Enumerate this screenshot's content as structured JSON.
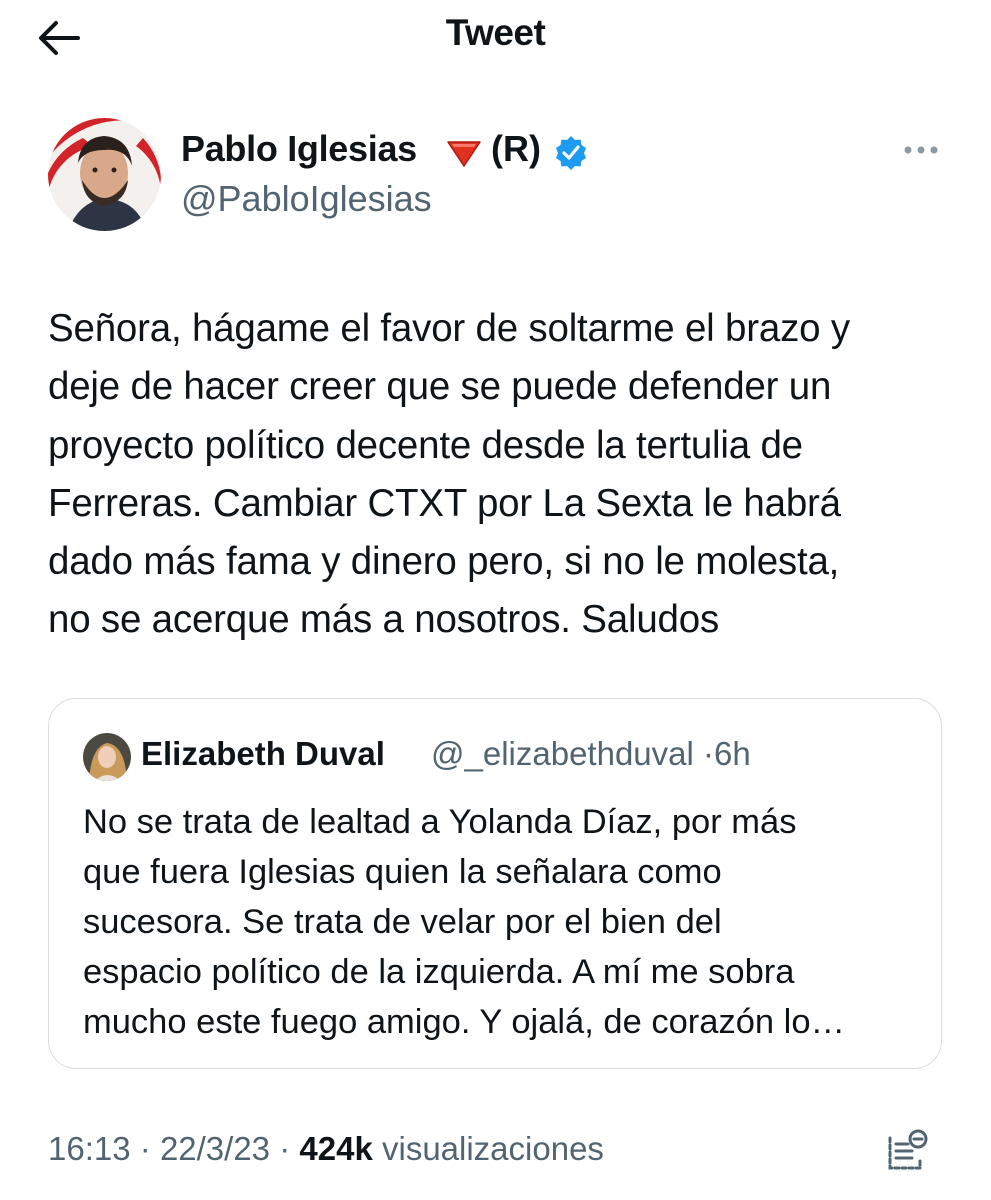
{
  "header": {
    "title": "Tweet",
    "back_icon": "arrow-left-icon"
  },
  "author": {
    "name": "Pablo Iglesias",
    "flag_icon": "red-triangle-down-icon",
    "tag": "(R)",
    "verified_icon": "verified-badge-icon",
    "handle": "@PabloIglesias",
    "more_icon": "more-horizontal-icon"
  },
  "tweet": {
    "text": "Señora, hágame el favor de soltarme el brazo y\ndeje de hacer creer que se puede defender un\nproyecto político decente desde la tertulia de\nFerreras. Cambiar CTXT por La Sexta le habrá\ndado más fama y dinero pero, si no le molesta,\nno se acerque más a nosotros. Saludos"
  },
  "quoted_tweet": {
    "name": "Elizabeth Duval",
    "handle": "@_elizabethduval",
    "separator": "·",
    "time": "6h",
    "text": "No se trata de lealtad a Yolanda Díaz, por más\nque fuera Iglesias quien la señalara como\nsucesora. Se trata de velar por el bien del\nespacio político de la izquierda. A mí me sobra\nmucho este fuego amigo. Y ojalá, de corazón lo…"
  },
  "footer": {
    "time": "16:13",
    "sep1": "·",
    "date": "22/3/23",
    "sep2": "·",
    "views_count": "424k",
    "views_label": "visualizaciones",
    "analytics_icon": "analytics-icon"
  },
  "colors": {
    "text_primary": "#0f1419",
    "text_secondary": "#536471",
    "verified_blue": "#1d9bf0",
    "flag_red": "#e0301e",
    "border": "#d8dde2"
  }
}
